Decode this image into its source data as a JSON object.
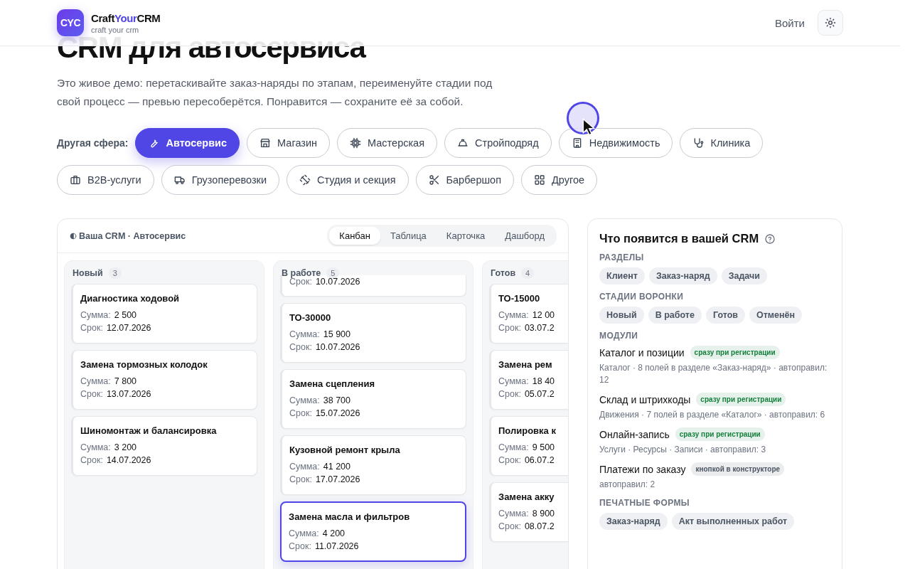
{
  "header": {
    "logo_mark": "CYC",
    "brand": [
      {
        "text": "Craft",
        "accent": false
      },
      {
        "text": "Your",
        "accent": true
      },
      {
        "text": "CRM",
        "accent": false
      }
    ],
    "tagline": "craft your crm",
    "login": "Войти"
  },
  "hero": {
    "title": "CRM для автосервиса",
    "description": "Это живое демо: перетаскивайте заказ-наряды по этапам, переименуйте стадии под свой процесс — превью пересоберётся. Понравится — сохраните её за собой."
  },
  "spheres": {
    "label": "Другая сфера:",
    "items": [
      {
        "label": "Автосервис",
        "selected": true
      },
      {
        "label": "Магазин",
        "selected": false
      },
      {
        "label": "Мастерская",
        "selected": false
      },
      {
        "label": "Стройподряд",
        "selected": false
      },
      {
        "label": "Недвижимость",
        "selected": false
      },
      {
        "label": "Клиника",
        "selected": false
      },
      {
        "label": "B2B-услуги",
        "selected": false
      },
      {
        "label": "Грузоперевозки",
        "selected": false
      },
      {
        "label": "Студия и секция",
        "selected": false
      },
      {
        "label": "Барбершоп",
        "selected": false
      },
      {
        "label": "Другое",
        "selected": false
      }
    ]
  },
  "preview": {
    "title": "Ваша CRM · Автосервис",
    "views": [
      {
        "label": "Канбан",
        "selected": true
      },
      {
        "label": "Таблица",
        "selected": false
      },
      {
        "label": "Карточка",
        "selected": false
      },
      {
        "label": "Дашборд",
        "selected": false
      }
    ],
    "columns": [
      {
        "name": "Новый",
        "count": "3",
        "cards": [
          {
            "title": "Диагностика ходовой",
            "sum_label": "Сумма:",
            "sum": "2 500",
            "due_label": "Срок:",
            "due": "12.07.2026",
            "selected": false
          },
          {
            "title": "Замена тормозных колодок",
            "sum_label": "Сумма:",
            "sum": "7 800",
            "due_label": "Срок:",
            "due": "13.07.2026",
            "selected": false
          },
          {
            "title": "Шиномонтаж и балансировка",
            "sum_label": "Сумма:",
            "sum": "3 200",
            "due_label": "Срок:",
            "due": "14.07.2026",
            "selected": false
          }
        ]
      },
      {
        "name": "В работе",
        "count": "5",
        "cards": [
          {
            "due_label": "Срок:",
            "due": "10.07.2026",
            "selected": false
          },
          {
            "title": "ТО-30000",
            "sum_label": "Сумма:",
            "sum": "15 900",
            "due_label": "Срок:",
            "due": "10.07.2026",
            "selected": false
          },
          {
            "title": "Замена сцепления",
            "sum_label": "Сумма:",
            "sum": "38 700",
            "due_label": "Срок:",
            "due": "15.07.2026",
            "selected": false
          },
          {
            "title": "Кузовной ремонт крыла",
            "sum_label": "Сумма:",
            "sum": "41 200",
            "due_label": "Срок:",
            "due": "17.07.2026",
            "selected": false
          },
          {
            "title": "Замена масла и фильтров",
            "sum_label": "Сумма:",
            "sum": "4 200",
            "due_label": "Срок:",
            "due": "11.07.2026",
            "selected": true
          }
        ]
      },
      {
        "name": "Готов",
        "count": "4",
        "cards": [
          {
            "title": "ТО-15000",
            "sum_label": "Сумма:",
            "sum": "12 00",
            "due_label": "Срок:",
            "due": "03.07.2",
            "selected": false
          },
          {
            "title": "Замена рем",
            "sum_label": "Сумма:",
            "sum": "18 40",
            "due_label": "Срок:",
            "due": "05.07.2",
            "selected": false
          },
          {
            "title": "Полировка к",
            "sum_label": "Сумма:",
            "sum": "9 500",
            "due_label": "Срок:",
            "due": "06.07.2",
            "selected": false
          },
          {
            "title": "Замена акку",
            "sum_label": "Сумма:",
            "sum": "8 900",
            "due_label": "Срок:",
            "due": "08.07.2",
            "selected": false
          }
        ]
      }
    ]
  },
  "summary": {
    "title": "Что появится в вашей CRM",
    "sections": [
      {
        "heading": "РАЗДЕЛЫ",
        "kind": "chips",
        "items": [
          "Клиент",
          "Заказ-наряд",
          "Задачи"
        ]
      },
      {
        "heading": "СТАДИИ ВОРОНКИ",
        "kind": "chips",
        "items": [
          "Новый",
          "В работе",
          "Готов",
          "Отменён"
        ]
      },
      {
        "heading": "МОДУЛИ",
        "kind": "modules",
        "modules": [
          {
            "name": "Каталог и позиции",
            "tag": "сразу при регистрации",
            "color": "#15803d",
            "details": "Каталог · 8 полей в разделе «Заказ-наряд» · автоправил: 12"
          },
          {
            "name": "Склад и штрихкоды",
            "tag": "сразу при регистрации",
            "color": "#15803d",
            "details": "Движения · 7 полей в разделе «Каталог» · автоправил: 6"
          },
          {
            "name": "Онлайн-запись",
            "tag": "сразу при регистрации",
            "color": "#15803d",
            "details": "Услуги · Ресурсы · Записи · автоправил: 3"
          },
          {
            "name": "Платежи по заказу",
            "tag": "кнопкой в конструкторе",
            "color": "#4b5563",
            "details": "автоправил: 2"
          }
        ]
      },
      {
        "heading": "ПЕЧАТНЫЕ ФОРМЫ",
        "kind": "chips",
        "items": [
          "Заказ-наряд",
          "Акт выполненных работ"
        ]
      }
    ]
  }
}
